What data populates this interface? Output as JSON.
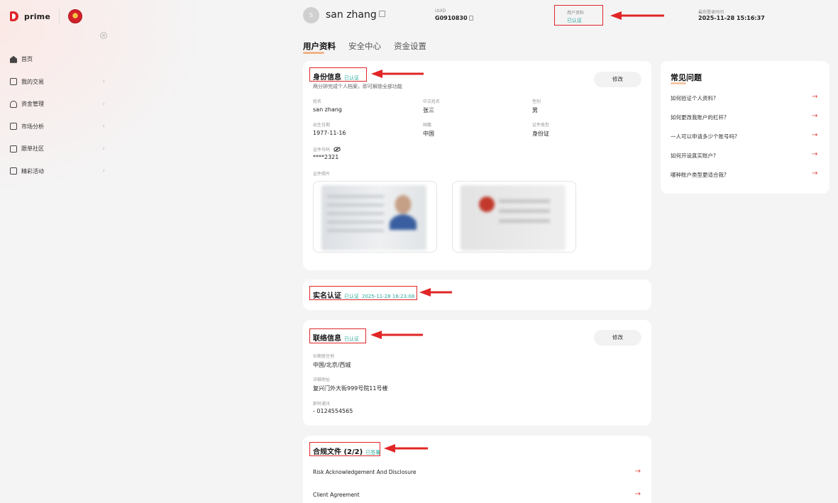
{
  "brand": {
    "logo_text": "prime"
  },
  "sidebar": {
    "items": [
      {
        "label": "首页",
        "icon": "home-icon"
      },
      {
        "label": "我的交易",
        "icon": "trade-icon"
      },
      {
        "label": "资金管理",
        "icon": "wallet-icon"
      },
      {
        "label": "市场分析",
        "icon": "chart-icon"
      },
      {
        "label": "跟单社区",
        "icon": "community-icon"
      },
      {
        "label": "精彩活动",
        "icon": "gift-icon"
      }
    ]
  },
  "header": {
    "avatar_letter": "S",
    "username": "san zhang",
    "uuid_label": "UUID",
    "uuid_value": "G0910830",
    "status_label": "用户资料",
    "status_value": "已认证",
    "last_login_label": "最后登录时间",
    "last_login_value": "2025-11-28 15:16:37"
  },
  "tabs": [
    "用户资料",
    "安全中心",
    "资金设置"
  ],
  "identity": {
    "title": "身份信息",
    "status": "已认证",
    "hint": "两分钟完成个人档案，即可解锁全部功能",
    "edit_label": "修改",
    "fields": {
      "name_label": "姓名",
      "name_value": "san zhang",
      "cn_name_label": "中文姓名",
      "cn_name_value": "张三",
      "gender_label": "性别",
      "gender_value": "男",
      "dob_label": "出生日期",
      "dob_value": "1977-11-16",
      "nationality_label": "国籍",
      "nationality_value": "中国",
      "idtype_label": "证件类型",
      "idtype_value": "身份证",
      "idno_label": "证件号码",
      "idno_value": "****2321",
      "photo_label": "证件照片"
    }
  },
  "realname": {
    "title": "实名认证",
    "status": "已认证",
    "time": "2025-11-28 16:23:08"
  },
  "contact": {
    "title": "联络信息",
    "status": "已认证",
    "edit_label": "修改",
    "residence_label": "长期居住地",
    "residence_value": "中国/北京/西城",
    "address_label": "详细地址",
    "address_value": "复兴门外大街999号院11号楼",
    "im_label": "即时通讯",
    "im_value": "-  0124554565"
  },
  "compliance": {
    "title": "合规文件 (2/2)",
    "status": "已签署",
    "docs": [
      "Risk Acknowledgement And Disclosure",
      "Client Agreement"
    ]
  },
  "faq": {
    "title": "常见问题",
    "items": [
      "如何验证个人资料?",
      "如何更改我账户的杠杆?",
      "一人可以申请多少个账号吗?",
      "如何开设真实账户?",
      "哪种账户类型更适合我?"
    ]
  },
  "colors": {
    "accent_red": "#e12626",
    "verified_teal": "#2aa89a",
    "arrow_red": "#e0443a"
  }
}
